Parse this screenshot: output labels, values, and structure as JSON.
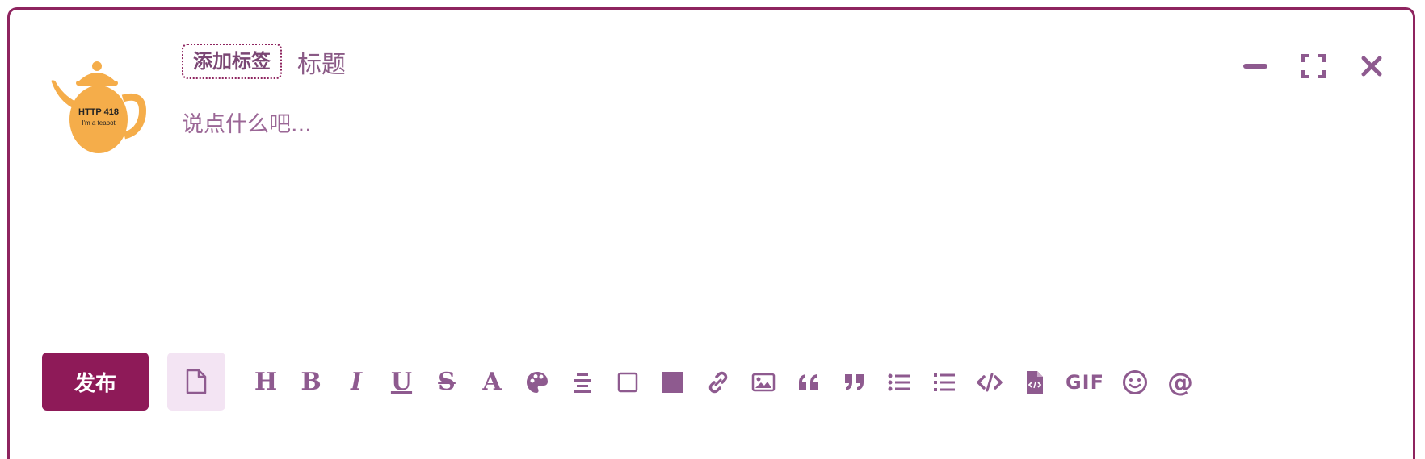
{
  "avatar": {
    "line1": "HTTP 418",
    "line2": "I'm a teapot",
    "color": "#f5ad4a"
  },
  "header": {
    "tag_label": "添加标签",
    "title_placeholder": "标题",
    "minimize_icon": "minimize-icon",
    "fullscreen_icon": "fullscreen-icon",
    "close_icon": "close-icon"
  },
  "editor": {
    "body_placeholder": "说点什么吧..."
  },
  "footer": {
    "publish_label": "发布",
    "draft_icon": "file-icon"
  },
  "toolbar": {
    "items": [
      {
        "name": "heading",
        "glyph": "H"
      },
      {
        "name": "bold",
        "glyph": "B"
      },
      {
        "name": "italic",
        "glyph": "I"
      },
      {
        "name": "underline",
        "glyph": "U"
      },
      {
        "name": "strikethrough",
        "glyph": "S"
      },
      {
        "name": "font-size",
        "glyph": "A"
      },
      {
        "name": "color-palette",
        "glyph": ""
      },
      {
        "name": "align-center",
        "glyph": ""
      },
      {
        "name": "checkbox-empty",
        "glyph": ""
      },
      {
        "name": "checkbox-filled",
        "glyph": ""
      },
      {
        "name": "link",
        "glyph": ""
      },
      {
        "name": "image",
        "glyph": ""
      },
      {
        "name": "quote-left",
        "glyph": ""
      },
      {
        "name": "quote-right",
        "glyph": ""
      },
      {
        "name": "bullet-list",
        "glyph": ""
      },
      {
        "name": "numbered-list",
        "glyph": ""
      },
      {
        "name": "code",
        "glyph": ""
      },
      {
        "name": "code-file",
        "glyph": ""
      },
      {
        "name": "gif",
        "glyph": "GIF"
      },
      {
        "name": "emoji",
        "glyph": ""
      },
      {
        "name": "mention",
        "glyph": "@"
      }
    ]
  },
  "colors": {
    "accent": "#8e245f",
    "primary_button": "#8e1a58",
    "icon": "#8e5a8f",
    "draft_bg": "#f3e4f3"
  }
}
